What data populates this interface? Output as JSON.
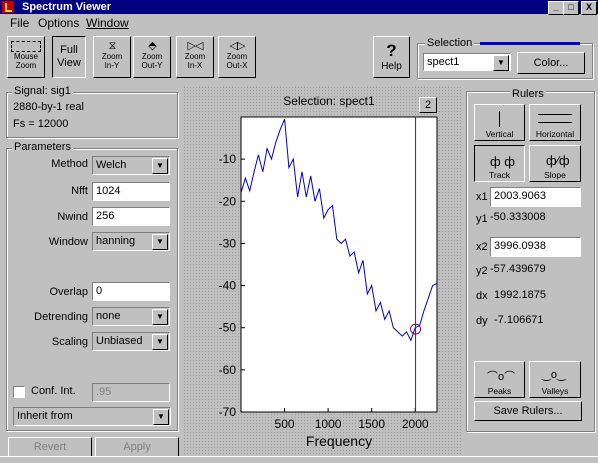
{
  "window": {
    "title": "Spectrum Viewer",
    "controls": [
      "_",
      "□",
      "X"
    ]
  },
  "menu": [
    "File",
    "Options",
    "Window"
  ],
  "toolbar": {
    "mouse_zoom": {
      "line1": "Mouse",
      "line2": "Zoom"
    },
    "full_view": {
      "line1": "Full",
      "line2": "View"
    },
    "zoom_in_y": {
      "line1": "Zoom",
      "line2": "In-Y"
    },
    "zoom_out_y": {
      "line1": "Zoom",
      "line2": "Out-Y"
    },
    "zoom_in_x": {
      "line1": "Zoom",
      "line2": "In-X"
    },
    "zoom_out_x": {
      "line1": "Zoom",
      "line2": "Out-X"
    },
    "help": {
      "symbol": "?",
      "label": "Help"
    }
  },
  "selection_panel": {
    "title": "Selection",
    "value": "spect1",
    "color_button": "Color..."
  },
  "signal": {
    "name": "Signal: sig1",
    "size": "2880-by-1 real",
    "fs": "Fs = 12000"
  },
  "parameters": {
    "title": "Parameters",
    "method": {
      "label": "Method",
      "value": "Welch"
    },
    "nfft": {
      "label": "Nfft",
      "value": "1024"
    },
    "nwind": {
      "label": "Nwind",
      "value": "256"
    },
    "window": {
      "label": "Window",
      "value": "hanning"
    },
    "overlap": {
      "label": "Overlap",
      "value": "0"
    },
    "detrending": {
      "label": "Detrending",
      "value": "none"
    },
    "scaling": {
      "label": "Scaling",
      "value": "Unbiased"
    },
    "conf_int": {
      "label": "Conf. Int.",
      "checked": false,
      "value": ".95"
    },
    "inherit": {
      "value": "Inherit from"
    },
    "revert": "Revert",
    "apply": "Apply"
  },
  "plot": {
    "title": "Selection: spect1",
    "figure_number": "2",
    "xlabel": "Frequency",
    "line_color": "#0000c8",
    "ruler_color": "#800080"
  },
  "chart_data": {
    "type": "line",
    "xlabel": "Frequency",
    "ylabel": "",
    "xlim": [
      0,
      2250
    ],
    "ylim": [
      -70,
      0
    ],
    "xticks": [
      500,
      1000,
      1500,
      2000
    ],
    "yticks": [
      -10,
      -20,
      -30,
      -40,
      -50,
      -60,
      -70
    ],
    "x": [
      0,
      50,
      100,
      150,
      200,
      250,
      300,
      350,
      400,
      450,
      500,
      550,
      600,
      650,
      700,
      750,
      800,
      850,
      900,
      950,
      1000,
      1050,
      1100,
      1150,
      1200,
      1250,
      1300,
      1350,
      1400,
      1450,
      1500,
      1550,
      1600,
      1650,
      1700,
      1750,
      1800,
      1850,
      1900,
      1950,
      2000,
      2050,
      2100,
      2150,
      2200,
      2250
    ],
    "y": [
      -18,
      -14.5,
      -17.5,
      -13,
      -9,
      -13,
      -7.5,
      -10,
      -6,
      -3,
      -0.5,
      -12,
      -10,
      -19,
      -13,
      -19,
      -14,
      -20,
      -17,
      -24,
      -22,
      -21,
      -29,
      -30,
      -29,
      -33,
      -32,
      -37,
      -34,
      -42,
      -40,
      -46,
      -44,
      -48,
      -46,
      -50,
      -51,
      -52,
      -51,
      -53,
      -50,
      -49.5,
      -46,
      -43,
      -40,
      -39.5
    ],
    "rulers": {
      "vertical_x": [
        2003.9063
      ],
      "marker": {
        "x": 2003.9063,
        "y": -50.333008
      }
    }
  },
  "rulers": {
    "title": "Rulers",
    "vertical": "Vertical",
    "horizontal": "Horizontal",
    "track": "Track",
    "slope": "Slope",
    "x1_label": "x1",
    "x1_value": "2003.9063",
    "y1_label": "y1",
    "y1_value": "-50.333008",
    "x2_label": "x2",
    "x2_value": "3996.0938",
    "y2_label": "y2",
    "y2_value": "-57.439679",
    "dx_label": "dx",
    "dx_value": "1992.1875",
    "dy_label": "dy",
    "dy_value": "-7.106671",
    "peaks": "Peaks",
    "valleys": "Valleys",
    "save": "Save Rulers..."
  }
}
